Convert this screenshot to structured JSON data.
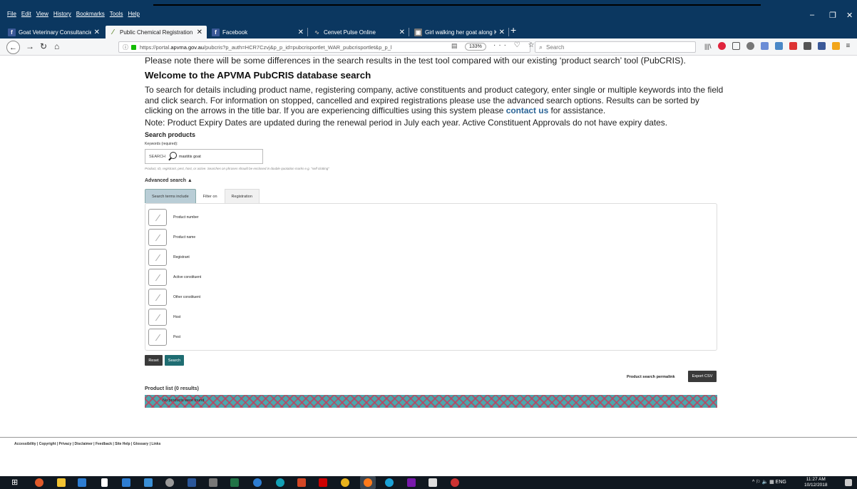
{
  "browser": {
    "menu": [
      "File",
      "Edit",
      "View",
      "History",
      "Bookmarks",
      "Tools",
      "Help"
    ],
    "window_controls": {
      "minimize": "–",
      "restore": "❐",
      "close": "✕"
    },
    "tabs": [
      {
        "title": "Goat Veterinary Consultancies",
        "favicon": "facebook-icon",
        "color": "#3b5998"
      },
      {
        "title": "Public Chemical Registration Inf",
        "favicon": "leaf-icon",
        "color": "#6a8f3b"
      },
      {
        "title": "Facebook",
        "favicon": "facebook-icon",
        "color": "#3b5998"
      },
      {
        "title": "Cenvet Pulse Online",
        "favicon": "pulse-icon",
        "color": "#888888"
      },
      {
        "title": "Girl walking her goat along Kor",
        "favicon": "image-icon",
        "color": "#777777"
      }
    ],
    "new_tab": "+",
    "url": {
      "prefix": "https://portal.",
      "domain": "apvma.gov.au",
      "rest": "/pubcris?p_auth=HCR7Czvj&p_p_id=pubcrisportlet_WAR_pubcrisportlet&p_p_l"
    },
    "zoom": "133%",
    "page_actions": "··· ♡ ☆",
    "search_placeholder": "Search"
  },
  "page": {
    "note_top": "Please note there will be some differences in the search results in the test tool compared with our existing ‘product search’ tool (PubCRIS).",
    "welcome_title": "Welcome to the APVMA PubCRIS database search",
    "intro_before": "To search for details including product name, registering company, active constituents and product category, enter single or multiple keywords into the field and click search. For information on stopped, cancelled and expired registrations please use the advanced search options. Results can be sorted by clicking on the arrows in the title bar. If you are experiencing difficulties using this system please ",
    "intro_link": "contact us",
    "intro_after": " for assistance.",
    "expiry_note": "Note: Product Expiry Dates are updated during the renewal period in July each year. Active Constituent Approvals do not have expiry dates.",
    "search_heading": "Search products",
    "keywords_label": "Keywords (required):",
    "search_label": "SEARCH",
    "search_value": "mastitis goat",
    "hint": "Product, ID, registrant, pest, host, or active. Searches on phrases should be enclosed in double quotation marks e.g. \"self clotting\"",
    "advanced_search": "Advanced search ▲",
    "tabs": [
      "Search terms include",
      "Filter on",
      "Registration"
    ],
    "checkboxes": [
      "Product number",
      "Product name",
      "Registrant",
      "Active constituent",
      "Other constituent",
      "Host",
      "Pest"
    ],
    "reset_label": "Reset",
    "search_button": "Search",
    "permalink": "Product search permalink",
    "export_csv": "Export CSV",
    "product_list": "Product list (0 results)",
    "no_products": "No products were found",
    "footer": "Accessibility | Copyright | Privacy | Disclaimer | Feedback | Site Help | Glossary | Links"
  },
  "taskbar": {
    "tray": "^ ⚐ 🔈 ▦ ENG",
    "time": "11:27 AM",
    "date": "10/12/2018"
  }
}
